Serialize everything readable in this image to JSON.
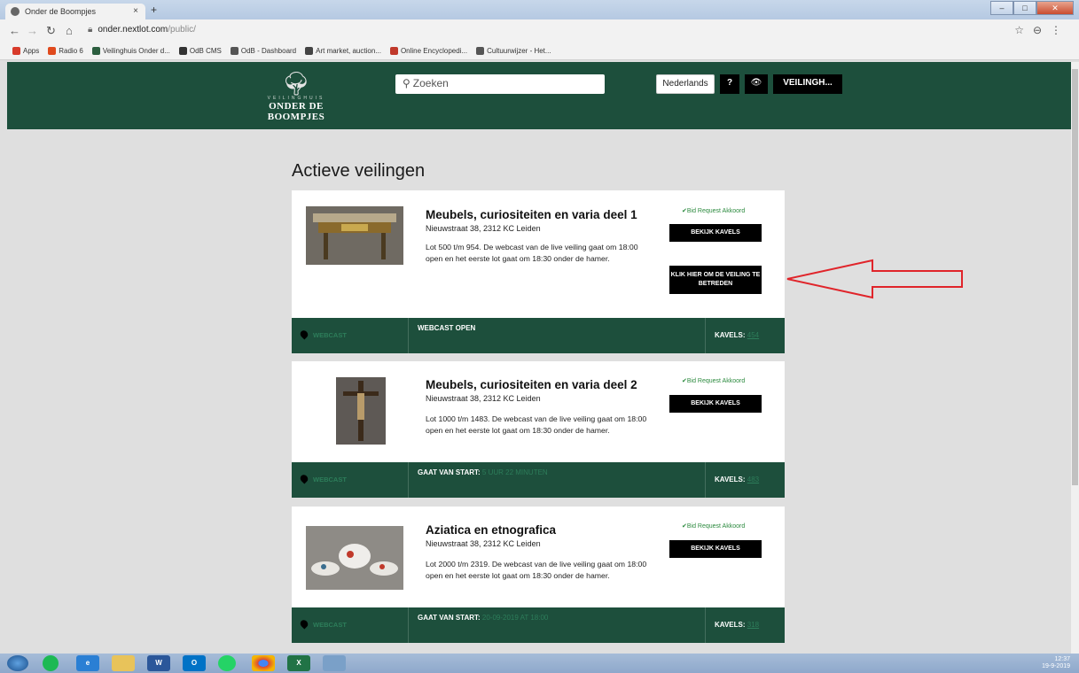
{
  "browser": {
    "tab_title": "Onder de Boompjes",
    "tab_close": "×",
    "new_tab": "+",
    "url_domain": "onder.nextlot.com",
    "url_path": "/public/",
    "bookmarks": [
      {
        "label": "Apps",
        "color": "#d83b2b"
      },
      {
        "label": "Radio 6",
        "color": "#e04a1d"
      },
      {
        "label": "Veilinghuis Onder d...",
        "color": "#2c5e3f"
      },
      {
        "label": "OdB CMS",
        "color": "#333333"
      },
      {
        "label": "OdB - Dashboard",
        "color": "#555555"
      },
      {
        "label": "Art market, auction...",
        "color": "#444444"
      },
      {
        "label": "Online Encyclopedi...",
        "color": "#c0392b"
      },
      {
        "label": "Cultuurwijzer - Het...",
        "color": "#555555"
      }
    ]
  },
  "header": {
    "logo_sub": "VEILINGHUIS",
    "logo_main": "ONDER DE BOOMPJES",
    "search_placeholder": "Zoeken",
    "language": "Nederlands",
    "help": "?",
    "auction_menu": "VEILINGH..."
  },
  "main": {
    "title": "Actieve veilingen",
    "auctions": [
      {
        "title": "Meubels, curiositeiten en varia deel 1",
        "address": "Nieuwstraat 38, 2312 KC Leiden",
        "description": "Lot 500 t/m 954. De webcast van de live veiling gaat om 18:00 open en het eerste lot gaat om 18:30 onder de hamer.",
        "badge": "✔Bid Request Akkoord",
        "view_lots": "BEKIJK KAVELS",
        "enter": "KLIK HIER OM DE VEILING TE BETREDEN",
        "webcast": "WEBCAST",
        "status_label": "WEBCAST OPEN",
        "status_value": "",
        "lots_label": "KAVELS:",
        "lots_count": "454"
      },
      {
        "title": "Meubels, curiositeiten en varia deel 2",
        "address": "Nieuwstraat 38, 2312 KC Leiden",
        "description": "Lot 1000 t/m 1483. De webcast van de live veiling gaat om 18:00 open en het eerste lot gaat om 18:30 onder de hamer.",
        "badge": "✔Bid Request Akkoord",
        "view_lots": "BEKIJK KAVELS",
        "webcast": "WEBCAST",
        "status_label": "GAAT VAN START:",
        "status_value": "5 UUR 22 MINUTEN",
        "lots_label": "KAVELS:",
        "lots_count": "483"
      },
      {
        "title": "Aziatica en etnografica",
        "address": "Nieuwstraat 38, 2312 KC Leiden",
        "description": "Lot 2000 t/m 2319. De webcast van de live veiling gaat om 18:00 open en het eerste lot gaat om 18:30 onder de hamer.",
        "badge": "✔Bid Request Akkoord",
        "view_lots": "BEKIJK KAVELS",
        "webcast": "WEBCAST",
        "status_label": "GAAT VAN START:",
        "status_value": "20-09-2019 AT 18:00",
        "lots_label": "KAVELS:",
        "lots_count": "318"
      }
    ]
  },
  "taskbar": {
    "time": "12:37",
    "date": "19-9-2019"
  },
  "colors": {
    "brand_green": "#1d4f3c",
    "annotation_arrow": "#e0242a"
  }
}
